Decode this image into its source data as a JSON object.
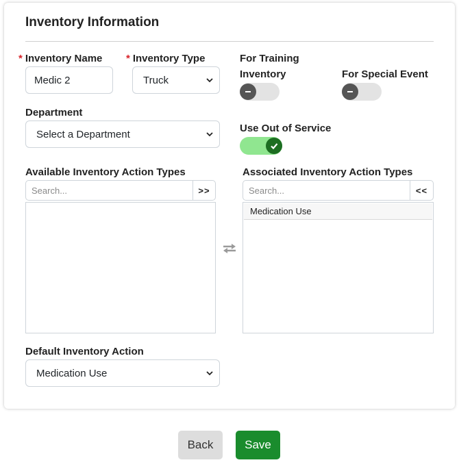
{
  "form": {
    "title": "Inventory Information",
    "required_marker": "*",
    "inventory_name": {
      "label": "Inventory Name",
      "value": "Medic 2"
    },
    "inventory_type": {
      "label": "Inventory Type",
      "value": "Truck"
    },
    "for_training": {
      "label_line1": "For Training",
      "label_line2": "Inventory",
      "enabled": false
    },
    "for_special_event": {
      "label": "For Special Event",
      "enabled": false
    },
    "department": {
      "label": "Department",
      "value": "Select a Department"
    },
    "use_out_of_service": {
      "label": "Use Out of Service",
      "enabled": true
    },
    "available_actions": {
      "label": "Available Inventory Action Types",
      "search_placeholder": "Search...",
      "move_button": ">>",
      "items": []
    },
    "transfer_icon": "swap-arrows-icon",
    "associated_actions": {
      "label": "Associated Inventory Action Types",
      "search_placeholder": "Search...",
      "move_button": "<<",
      "items": [
        "Medication Use"
      ]
    },
    "default_action": {
      "label": "Default Inventory Action",
      "value": "Medication Use"
    }
  },
  "actions": {
    "back_label": "Back",
    "save_label": "Save"
  },
  "colors": {
    "required": "#d8232a",
    "toggle_on_track": "#90e690",
    "toggle_on_knob": "#1d6e22",
    "toggle_off_knob": "#555555",
    "save_button": "#1a8c2d"
  }
}
